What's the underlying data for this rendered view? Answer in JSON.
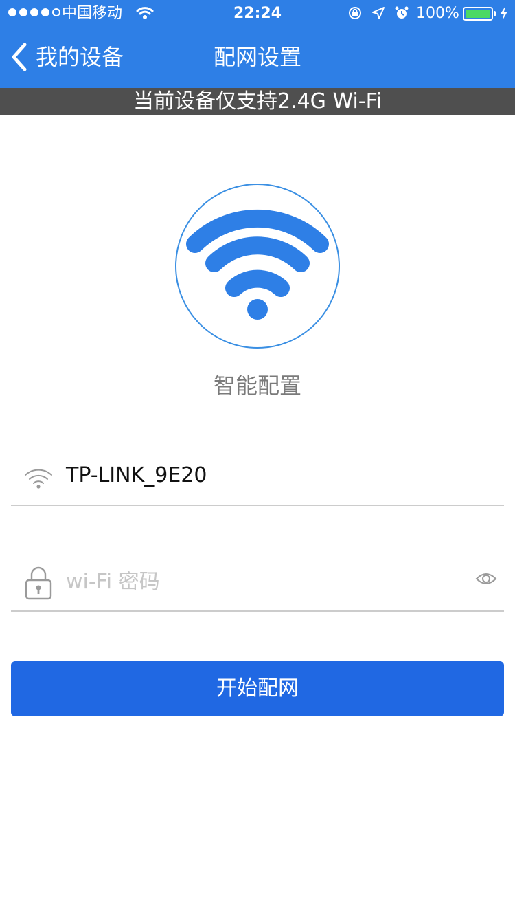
{
  "status_bar": {
    "carrier": "中国移动",
    "time": "22:24",
    "battery_percent": "100%",
    "signal_dots_filled": 4,
    "signal_dots_total": 5,
    "colors": {
      "battery_fill": "#4cd964"
    }
  },
  "nav": {
    "back_label": "我的设备",
    "title": "配网设置",
    "background": "#2e7fe6"
  },
  "notice": {
    "text": "当前设备仅支持2.4G Wi-Fi",
    "background": "#4f4f4f"
  },
  "mode": {
    "icon": "wifi-icon",
    "label": "智能配置",
    "color": "#2e7fe6"
  },
  "ssid": {
    "icon": "wifi-icon",
    "value": "TP-LINK_9E20"
  },
  "password": {
    "icon": "lock-icon",
    "placeholder": "wi-Fi 密码",
    "value": "",
    "toggle_icon": "eye-icon"
  },
  "start_button": {
    "label": "开始配网",
    "color": "#2068e3"
  }
}
